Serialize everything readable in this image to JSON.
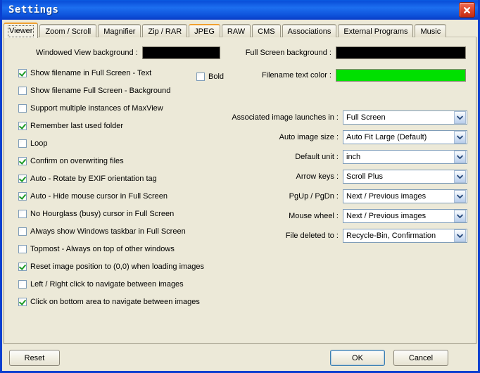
{
  "window": {
    "title": "Settings",
    "close_icon": "close-icon"
  },
  "tabs": [
    {
      "label": "Viewer",
      "active": true,
      "accent": true
    },
    {
      "label": "Zoom / Scroll",
      "active": false,
      "accent": false
    },
    {
      "label": "Magnifier",
      "active": false,
      "accent": false
    },
    {
      "label": "Zip / RAR",
      "active": false,
      "accent": false
    },
    {
      "label": "JPEG",
      "active": false,
      "accent": true
    },
    {
      "label": "RAW",
      "active": false,
      "accent": false
    },
    {
      "label": "CMS",
      "active": false,
      "accent": false
    },
    {
      "label": "Associations",
      "active": false,
      "accent": false
    },
    {
      "label": "External Programs",
      "active": false,
      "accent": false
    },
    {
      "label": "Music",
      "active": false,
      "accent": false
    }
  ],
  "colors": {
    "windowed_view_background": {
      "label": "Windowed View background :",
      "value": "#000000"
    },
    "full_screen_background": {
      "label": "Full Screen background :",
      "value": "#000000"
    },
    "filename_text_color": {
      "label": "Filename text color :",
      "value": "#00E000"
    }
  },
  "checkboxes": [
    {
      "label": "Show filename in Full Screen - Text",
      "checked": true
    },
    {
      "label": "Show filename Full Screen - Background",
      "checked": false
    },
    {
      "label": "Support multiple instances of MaxView",
      "checked": false
    },
    {
      "label": "Remember last used folder",
      "checked": true
    },
    {
      "label": "Loop",
      "checked": false
    },
    {
      "label": "Confirm on overwriting files",
      "checked": true
    },
    {
      "label": "Auto - Rotate by EXIF orientation tag",
      "checked": true
    },
    {
      "label": "Auto - Hide mouse cursor in Full Screen",
      "checked": true
    },
    {
      "label": "No Hourglass (busy) cursor in Full Screen",
      "checked": false
    },
    {
      "label": "Always show Windows taskbar in Full Screen",
      "checked": false
    },
    {
      "label": "Topmost - Always on top of other windows",
      "checked": false
    },
    {
      "label": "Reset image position to (0,0) when loading images",
      "checked": true
    },
    {
      "label": "Left / Right click to navigate between images",
      "checked": false
    },
    {
      "label": "Click on bottom area to navigate between images",
      "checked": true
    }
  ],
  "bold_checkbox": {
    "label": "Bold",
    "checked": false
  },
  "combos": [
    {
      "label": "Associated image launches in :",
      "value": "Full Screen"
    },
    {
      "label": "Auto image size :",
      "value": "Auto Fit Large (Default)"
    },
    {
      "label": "Default unit :",
      "value": "inch"
    },
    {
      "label": "Arrow keys :",
      "value": "Scroll Plus"
    },
    {
      "label": "PgUp / PgDn :",
      "value": "Next / Previous images"
    },
    {
      "label": "Mouse wheel :",
      "value": "Next / Previous images"
    },
    {
      "label": "File deleted to :",
      "value": "Recycle-Bin, Confirmation"
    }
  ],
  "buttons": {
    "reset": "Reset",
    "ok": "OK",
    "cancel": "Cancel"
  }
}
